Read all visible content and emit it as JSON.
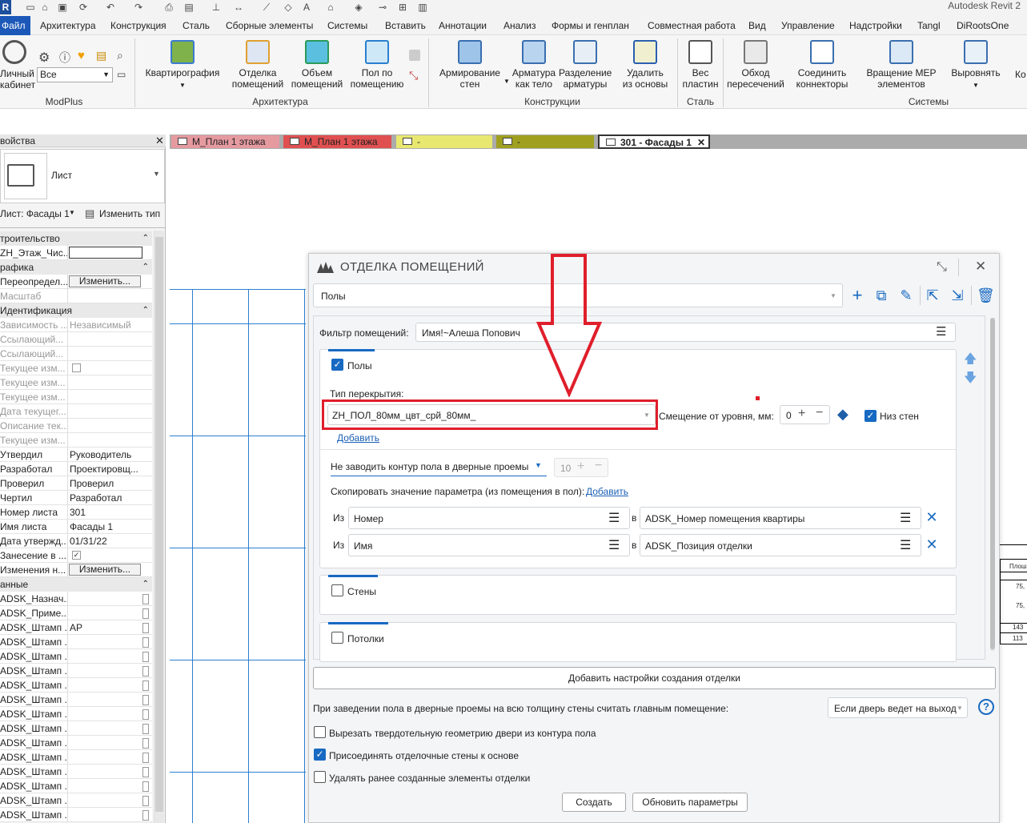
{
  "app": {
    "title": "Autodesk Revit 2"
  },
  "menu": {
    "file": "Файл",
    "items": [
      "Архитектура",
      "Конструкция",
      "Сталь",
      "Сборные элементы",
      "Системы",
      "Вставить",
      "Аннотации",
      "Анализ",
      "Формы и генплан",
      "Совместная работа",
      "Вид",
      "Управление",
      "Надстройки",
      "Tangl",
      "DiRootsOne"
    ]
  },
  "ribbon": {
    "modplus": {
      "personal": "Личный\nкабинет",
      "combo": "Все",
      "group": "ModPlus"
    },
    "arch": {
      "btn1": "Квартирография",
      "btn2": "Отделка\nпомещений",
      "btn3": "Объем\nпомещений",
      "btn4": "Пол по\nпомещению",
      "group": "Архитектура"
    },
    "constr": {
      "btn1": "Армирование\nстен",
      "btn2": "Арматура\nкак тело",
      "btn3": "Разделение\nарматуры",
      "btn4": "Удалить\nиз основы",
      "group": "Конструкции"
    },
    "steel": {
      "btn1": "Вес\nпластин",
      "group": "Сталь"
    },
    "sys": {
      "btn1": "Обход\nпересечений",
      "btn2": "Соединить\nконнекторы",
      "btn3": "Вращение MEP\nэлементов",
      "btn4": "Выровнять",
      "btn5": "Ко",
      "group": "Системы"
    }
  },
  "props": {
    "title": "войства",
    "type_name": "Лист",
    "selector": "Лист: Фасады 1",
    "edit_type": "Изменить тип",
    "groups": {
      "g1": "троительство",
      "g2": "рафика",
      "g3": "Идентификация",
      "g4": "анные"
    },
    "rows": {
      "r1k": "ZH_Этаж_Чис...",
      "r2k": "Переопредел...",
      "r2btn": "Изменить...",
      "r3k": "Масштаб",
      "r4k": "Зависимость ...",
      "r4v": "Независимый",
      "r5k": "Ссылающий...",
      "r6k": "Ссылающий...",
      "r7k": "Текущее изм...",
      "r8k": "Текущее изм...",
      "r9k": "Текущее изм...",
      "r10k": "Дата текущег...",
      "r11k": "Описание тек...",
      "r12k": "Текущее изм...",
      "r13k": "Утвердил",
      "r13v": "Руководитель",
      "r14k": "Разработал",
      "r14v": "Проектировщ...",
      "r15k": "Проверил",
      "r15v": "Проверил",
      "r16k": "Чертил",
      "r16v": "Разработал",
      "r17k": "Номер листа",
      "r17v": "301",
      "r18k": "Имя листа",
      "r18v": "Фасады 1",
      "r19k": "Дата утвержд...",
      "r19v": "01/31/22",
      "r20k": "Занесение в ...",
      "r21k": "Изменения н...",
      "r21btn": "Изменить...",
      "d1k": "ADSK_Назнач...",
      "d2k": "ADSK_Приме...",
      "d3k": "ADSK_Штамп ...",
      "d3v": "АР",
      "dk": "ADSK_Штамп ..."
    }
  },
  "tabs": [
    {
      "label": "М_План 1 этажа",
      "color": "#e59aa0"
    },
    {
      "label": "М_План 1 этажа",
      "color": "#e05050"
    },
    {
      "label": "-",
      "color": "#e8e870"
    },
    {
      "label": "-",
      "color": "#a0a020"
    },
    {
      "label": "301 - Фасады 1",
      "color": "#ffffff"
    }
  ],
  "colors": {
    "accent": "#1769c2",
    "highlight": "#e01e2b",
    "grid": "#2a7fd0"
  },
  "dialog": {
    "title": "ОТДЕЛКА ПОМЕЩЕНИЙ",
    "preset": "Полы",
    "filter_label": "Фильтр помещений:",
    "filter_value": "Имя!~Алеша Попович",
    "floors": {
      "label": "Полы",
      "type_label": "Тип перекрытия:",
      "type_value": "ZH_ПОЛ_80мм_цвт_срй_80мм_",
      "add": "Добавить",
      "offset_label": "Смещение от уровня, мм:",
      "offset_value": "0",
      "bottom_walls": "Низ стен",
      "door_mode": "Не заводить контур пола в дверные проемы",
      "door_value": "10",
      "copy_label": "Скопировать значение параметра (из помещения в пол):",
      "copy_add": "Добавить",
      "from": "Из",
      "to": "в",
      "map1_from": "Номер",
      "map1_to": "ADSK_Номер помещения квартиры",
      "map2_from": "Имя",
      "map2_to": "ADSK_Позиция отделки"
    },
    "walls": {
      "label": "Стены"
    },
    "ceilings": {
      "label": "Потолки"
    },
    "add_settings": "Добавить настройки создания отделки",
    "main_room_label": "При заведении пола в дверные проемы на всю толщину стены считать главным помещение:",
    "main_room_value": "Если дверь ведет на выход",
    "opt1": "Вырезать твердотельную геометрию двери из контура пола",
    "opt2": "Присоединять отделочные стены к основе",
    "opt3": "Удалять ранее созданные элементы отделки",
    "create": "Создать",
    "update": "Обновить параметры"
  },
  "table_fragment": {
    "h": "Плош",
    "c1": "75,",
    "c2": "75,",
    "c3": "143",
    "c4": "113"
  }
}
